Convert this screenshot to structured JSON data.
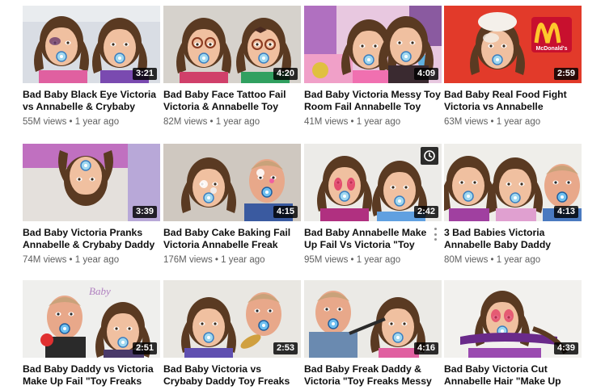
{
  "icons": {
    "more": "vertical-ellipsis-icon",
    "watch_later": "clock-icon"
  },
  "thumbnail_text": {
    "mcdonalds": "McDonald's",
    "baby": "Baby"
  },
  "colors": {
    "duration_bg": "#000000",
    "title": "#0f0f0f",
    "meta": "#606060"
  },
  "rows": [
    {
      "videos": [
        {
          "title": "Bad Baby Black Eye Victoria vs Annabelle & Crybaby",
          "duration": "3:21",
          "views": "55M views",
          "age": "1 year ago"
        },
        {
          "title": "Bad Baby Face Tattoo Fail Victoria & Annabelle Toy",
          "duration": "4:20",
          "views": "82M views",
          "age": "1 year ago"
        },
        {
          "title": "Bad Baby Victoria Messy Toy Room Fail Annabelle Toy",
          "duration": "4:09",
          "views": "41M views",
          "age": "1 year ago"
        },
        {
          "title": "Bad Baby Real Food Fight Victoria vs Annabelle",
          "duration": "2:59",
          "views": "63M views",
          "age": "1 year ago"
        }
      ]
    },
    {
      "videos": [
        {
          "title": "Bad Baby Victoria Pranks Annabelle & Crybaby Daddy",
          "duration": "3:39",
          "views": "74M views",
          "age": "1 year ago"
        },
        {
          "title": "Bad Baby Cake Baking Fail Victoria Annabelle Freak",
          "duration": "4:15",
          "views": "176M views",
          "age": "1 year ago"
        },
        {
          "title": "Bad Baby Annabelle Make Up Fail Vs Victoria \"Toy Freaks",
          "duration": "2:42",
          "views": "95M views",
          "age": "1 year ago"
        },
        {
          "title": "3 Bad Babies Victoria Annabelle Baby Daddy",
          "duration": "4:13",
          "views": "80M views",
          "age": "1 year ago"
        }
      ]
    },
    {
      "videos": [
        {
          "title": "Bad Baby Daddy vs Victoria Make Up Fail \"Toy Freaks",
          "duration": "2:51"
        },
        {
          "title": "Bad Baby Victoria vs Crybaby Daddy Toy Freaks Annabelle",
          "duration": "2:53"
        },
        {
          "title": "Bad Baby Freak Daddy & Victoria \"Toy Freaks Messy",
          "duration": "4:16"
        },
        {
          "title": "Bad Baby Victoria Cut Annabelle Hair \"Make Up Fail\"",
          "duration": "4:39"
        }
      ]
    }
  ]
}
